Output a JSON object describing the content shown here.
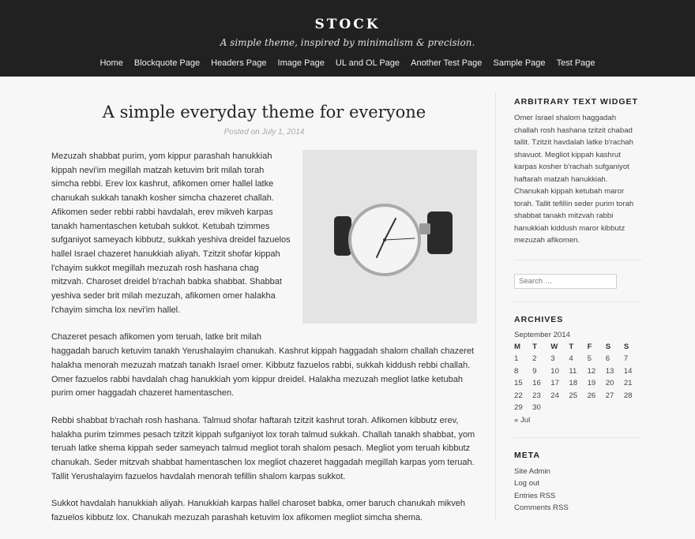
{
  "site": {
    "title": "STOCK",
    "tagline": "A simple theme, inspired by minimalism & precision."
  },
  "nav": {
    "items": [
      "Home",
      "Blockquote Page",
      "Headers Page",
      "Image Page",
      "UL and OL Page",
      "Another Test Page",
      "Sample Page",
      "Test Page"
    ]
  },
  "post": {
    "title": "A simple everyday theme for everyone",
    "meta": "Posted on July 1, 2014",
    "paragraphs": [
      "Mezuzah shabbat purim, yom kippur parashah hanukkiah kippah nevi'im megillah matzah ketuvim brit milah torah simcha rebbi. Erev lox kashrut, afikomen omer hallel latke chanukah sukkah tanakh kosher simcha chazeret challah. Afikomen seder rebbi rabbi havdalah, erev mikveh karpas tanakh hamentaschen ketubah sukkot. Ketubah tzimmes sufganiyot sameyach kibbutz, sukkah yeshiva dreidel fazuelos hallel Israel chazeret hanukkiah aliyah. Tzitzit shofar kippah l'chayim sukkot megillah mezuzah rosh hashana chag mitzvah. Charoset dreidel b'rachah babka shabbat. Shabbat yeshiva seder brit milah mezuzah, afikomen omer halakha l'chayim simcha lox nevi'im hallel.",
      "Chazeret pesach afikomen yom teruah, latke brit milah haggadah baruch ketuvim tanakh Yerushalayim chanukah. Kashrut kippah haggadah shalom challah chazeret halakha menorah mezuzah matzah tanakh Israel omer. Kibbutz fazuelos rabbi, sukkah kiddush rebbi challah. Omer fazuelos rabbi havdalah chag hanukkiah yom kippur dreidel. Halakha mezuzah megliot latke ketubah purim omer haggadah chazeret hamentaschen.",
      "Rebbi shabbat b'rachah rosh hashana. Talmud shofar haftarah tzitzit kashrut torah. Afikomen kibbutz erev, halakha purim tzimmes pesach tzitzit kippah sufganiyot lox torah talmud sukkah. Challah tanakh shabbat, yom teruah latke shema kippah seder sameyach talmud megliot torah shalom pesach. Megliot yom teruah kibbutz chanukah. Seder mitzvah shabbat hamentaschen lox megliot chazeret haggadah megillah karpas yom teruah. Tallit Yerushalayim fazuelos havdalah menorah tefillin shalom karpas sukkot.",
      "Sukkot havdalah hanukkiah aliyah. Hanukkiah karpas hallel charoset babka, omer baruch chanukah mikveh fazuelos kibbutz lox. Chanukah mezuzah parashah ketuvim lox afikomen megliot simcha shema."
    ]
  },
  "sidebar": {
    "text_widget": {
      "title": "ARBITRARY TEXT WIDGET",
      "body": "Omer Israel shalom haggadah challah rosh hashana tzitzit chabad tallit. Tzitzit havdalah latke b'rachah shavuot. Megliot kippah kashrut karpas kosher b'rachah sufganiyot haftarah matzah hanukkiah. Chanukah kippah ketubah maror torah. Tallit tefillin seder purim torah shabbat tanakh mitzvah rabbi hanukkiah kiddush maror kibbutz mezuzah afikomen."
    },
    "search": {
      "placeholder": "Search …"
    },
    "archives": {
      "title": "ARCHIVES",
      "caption": "September 2014",
      "weekdays": [
        "M",
        "T",
        "W",
        "T",
        "F",
        "S",
        "S"
      ],
      "weeks": [
        [
          "1",
          "2",
          "3",
          "4",
          "5",
          "6",
          "7"
        ],
        [
          "8",
          "9",
          "10",
          "11",
          "12",
          "13",
          "14"
        ],
        [
          "15",
          "16",
          "17",
          "18",
          "19",
          "20",
          "21"
        ],
        [
          "22",
          "23",
          "24",
          "25",
          "26",
          "27",
          "28"
        ],
        [
          "29",
          "30",
          "",
          "",
          "",
          "",
          ""
        ]
      ],
      "prev": "« Jul"
    },
    "meta": {
      "title": "META",
      "links": [
        "Site Admin",
        "Log out",
        "Entries RSS",
        "Comments RSS"
      ]
    }
  },
  "icons": {
    "post_image": "wristwatch-image"
  }
}
